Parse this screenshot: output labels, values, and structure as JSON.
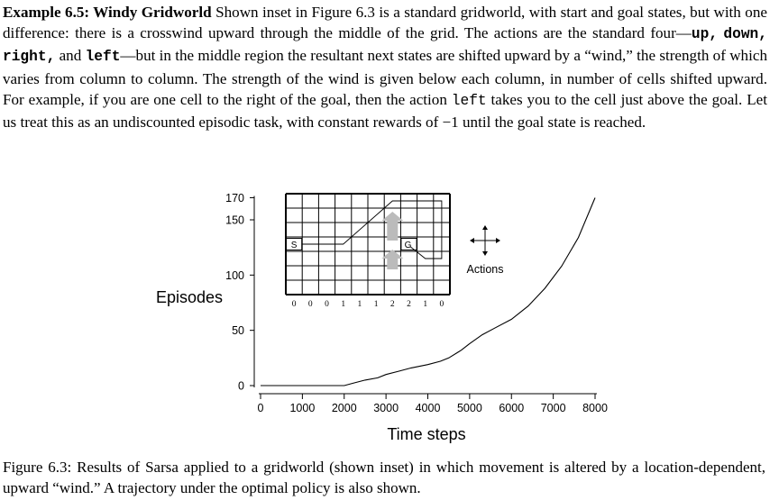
{
  "paragraph": {
    "title": "Example 6.5: Windy Gridworld",
    "s1": " Shown inset in Figure 6.3 is a standard gridworld, with start and goal states, but with one difference: there is a crosswind upward through the middle of the grid. The actions are the standard four—",
    "a_up": "up,",
    "a_down": "down,",
    "a_right": "right,",
    "and": " and ",
    "a_left": "left",
    "s2": "—but in the middle region the resultant next states are shifted upward by a “wind,” the strength of which varies from column to column. The strength of the wind is given below each column, in number of cells shifted upward. For example, if you are one cell to the right of the goal, then the action ",
    "a_left2": "left",
    "s3": " takes you to the cell just above the goal. Let us treat this as an undiscounted episodic task, with constant rewards of −1 until the goal state is reached."
  },
  "chart_data": {
    "type": "line",
    "xlabel": "Time steps",
    "ylabel": "Episodes",
    "xlim": [
      0,
      8000
    ],
    "ylim": [
      0,
      170
    ],
    "xticks": [
      0,
      1000,
      2000,
      3000,
      4000,
      5000,
      6000,
      7000,
      8000
    ],
    "yticks": [
      0,
      50,
      100,
      150,
      170
    ],
    "series": [
      {
        "name": "",
        "x": [
          0,
          2000,
          2200,
          2500,
          2800,
          3000,
          3300,
          3600,
          4000,
          4300,
          4500,
          4800,
          5000,
          5300,
          5600,
          6000,
          6400,
          6800,
          7200,
          7600,
          8000
        ],
        "y": [
          0,
          0,
          2,
          5,
          7,
          10,
          13,
          16,
          19,
          22,
          25,
          32,
          38,
          46,
          52,
          60,
          72,
          88,
          108,
          134,
          170
        ]
      }
    ],
    "grid": false,
    "inset": {
      "start_label": "S",
      "goal_label": "G",
      "wind_strengths": [
        "0",
        "0",
        "0",
        "1",
        "1",
        "1",
        "2",
        "2",
        "1",
        "0"
      ],
      "actions_label": "Actions"
    }
  },
  "caption": {
    "label": "Figure 6.3:",
    "text": " Results of Sarsa applied to a gridworld (shown inset) in which movement is altered by a location-dependent, upward “wind.” A trajectory under the optimal policy is also shown."
  }
}
